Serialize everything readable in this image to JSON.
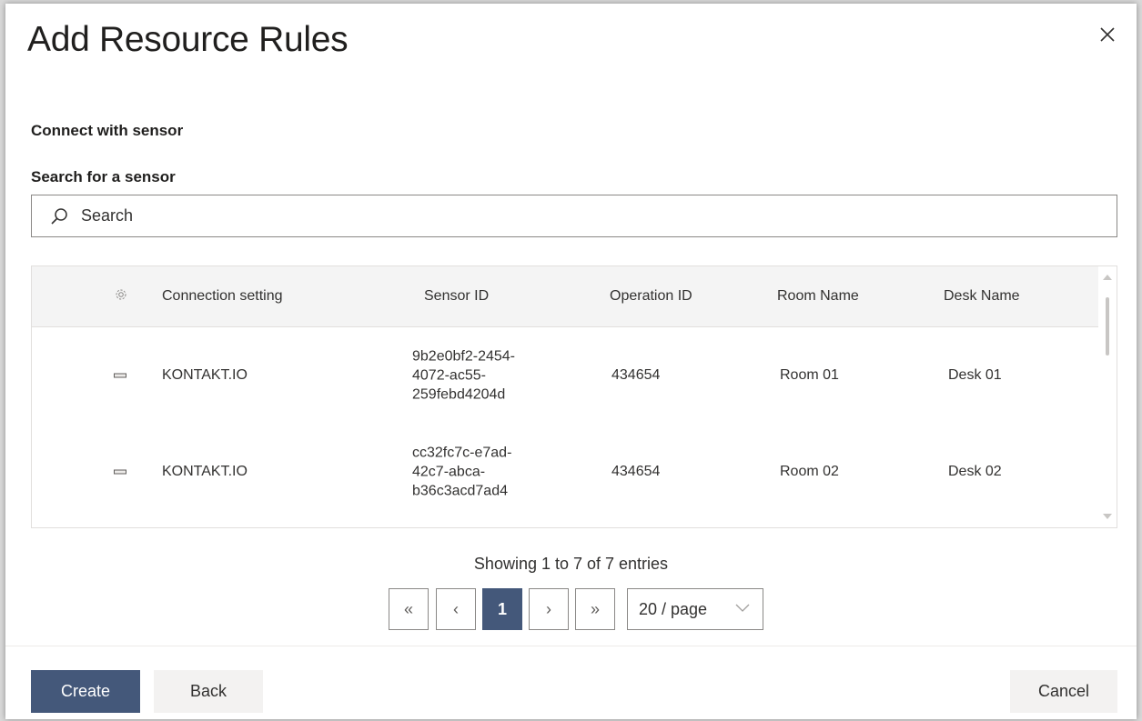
{
  "dialog": {
    "title": "Add Resource Rules",
    "section_title": "Connect with sensor",
    "search_label": "Search for a sensor",
    "search_placeholder": "Search"
  },
  "table": {
    "columns": {
      "settings_icon": "gear-icon",
      "connection_setting": "Connection setting",
      "sensor_id": "Sensor ID",
      "operation_id": "Operation ID",
      "room_name": "Room Name",
      "desk_name": "Desk Name"
    },
    "rows": [
      {
        "connection_setting": "KONTAKT.IO",
        "sensor_id_lines": [
          "9b2e0bf2-2454-",
          "4072-ac55-",
          "259febd4204d"
        ],
        "operation_id": "434654",
        "room_name": "Room 01",
        "desk_name": "Desk 01"
      },
      {
        "connection_setting": "KONTAKT.IO",
        "sensor_id_lines": [
          "cc32fc7c-e7ad-",
          "42c7-abca-",
          "b36c3acd7ad4"
        ],
        "operation_id": "434654",
        "room_name": "Room 02",
        "desk_name": "Desk 02"
      }
    ]
  },
  "pagination": {
    "summary": "Showing 1 to 7 of 7 entries",
    "first": "«",
    "prev": "‹",
    "current_page": "1",
    "next": "›",
    "last": "»",
    "page_size": "20 / page"
  },
  "footer": {
    "create": "Create",
    "back": "Back",
    "cancel": "Cancel"
  },
  "colors": {
    "primary": "#44587a",
    "secondary_button": "#f3f2f1",
    "table_header": "#f4f4f4"
  }
}
